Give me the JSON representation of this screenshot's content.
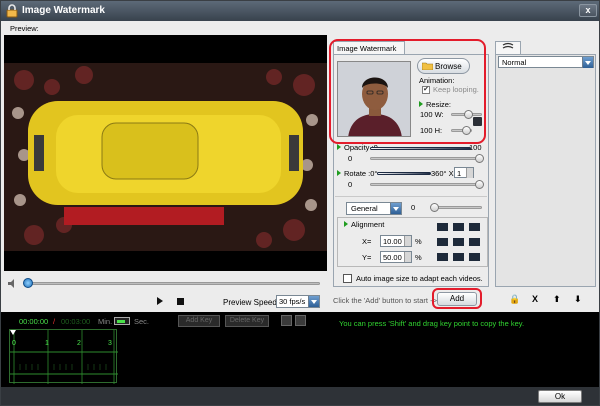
{
  "window": {
    "title": "Image Watermark",
    "close_label": "x"
  },
  "preview": {
    "label": "Preview:"
  },
  "player": {
    "speed_label": "Preview Speed:",
    "speed_value": "30 fps/s"
  },
  "watermark_panel": {
    "tab_label": "Image Watermark",
    "browse_label": "Browse",
    "animation_label": "Animation:",
    "keep_looping_label": "Keep looping.",
    "keep_looping_checked": true,
    "resize_label": "Resize:",
    "width_value": "100",
    "width_label": "W:",
    "height_value": "100",
    "height_label": "H:",
    "opacity_label": "Opacity :0",
    "opacity_max": "100",
    "opacity_value": "0",
    "rotate_label": "Rotate :0°",
    "rotate_max": "360°",
    "rotate_x": "X",
    "rotate_multiplier": "1",
    "rotate_value": "0",
    "blend_mode": "General",
    "blend_value": "0",
    "alignment_label": "Alignment",
    "x_label": "X=",
    "x_value": "10.00",
    "y_label": "Y=",
    "y_value": "50.00",
    "percent": "%",
    "auto_size_label": "Auto image size to adapt each videos.",
    "click_hint": "Click the 'Add' button to start ->",
    "add_label": "Add"
  },
  "right_panel": {
    "mode": "Normal",
    "buttons": [
      "🔒",
      "X",
      "⬆",
      "⬇"
    ]
  },
  "timeline": {
    "time_current": "00:00:00",
    "time_sep": "/",
    "time_total": "00:03:00",
    "min_label": "Min.",
    "sec_label": "Sec.",
    "add_key_label": "Add Key",
    "delete_key_label": "Delete Key",
    "hint": "You can press 'Shift' and drag key point to copy the key.",
    "ruler_labels": [
      "0",
      "1",
      "2",
      "3"
    ]
  },
  "footer": {
    "ok_label": "Ok"
  }
}
